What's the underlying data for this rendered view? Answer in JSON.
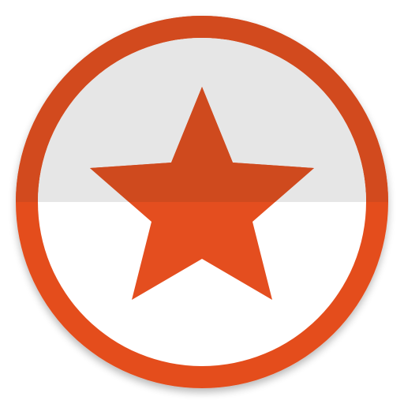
{
  "icon": {
    "name": "star-badge-icon",
    "shape": "five-point-star-in-ring"
  },
  "colors": {
    "ring": "#E44E1F",
    "ring_top_shade": "#D24A1E",
    "star": "#E44E1F",
    "star_top_shade": "#CF4A1E",
    "face_top": "#E6E6E6",
    "face_bottom": "#FFFFFF",
    "background": "#FFFFFF"
  }
}
